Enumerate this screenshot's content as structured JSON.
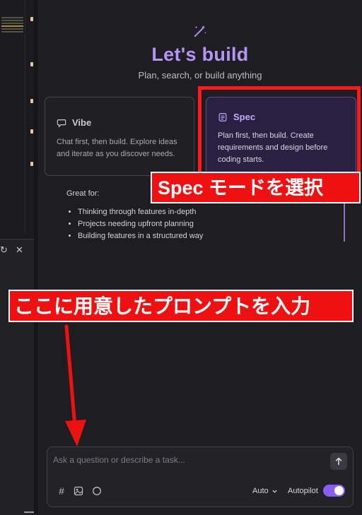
{
  "hero": {
    "title": "Let's build",
    "subtitle": "Plan, search, or build anything",
    "icon": "magic-wand-icon"
  },
  "modes": [
    {
      "id": "vibe",
      "label": "Vibe",
      "icon": "chat-bubble-icon",
      "description": "Chat first, then build. Explore ideas and iterate as you discover needs."
    },
    {
      "id": "spec",
      "label": "Spec",
      "icon": "document-icon",
      "description": "Plan first, then build. Create requirements and design before coding starts.",
      "selected": true
    }
  ],
  "spec_details": {
    "heading": "Great for:",
    "items": [
      "Thinking through features in-depth",
      "Projects needing upfront planning",
      "Building features in a structured way"
    ]
  },
  "annotations": {
    "select_spec": "Spec モードを選択",
    "enter_prompt": "ここに用意したプロンプトを入力"
  },
  "chat_input": {
    "placeholder": "Ask a question or describe a task...",
    "value": "",
    "model_select": "Auto",
    "autopilot_label": "Autopilot",
    "autopilot_on": true
  },
  "colors": {
    "accent": "#b794f6",
    "annotation_red": "#ef1111",
    "toggle_on": "#8c5cf6"
  }
}
